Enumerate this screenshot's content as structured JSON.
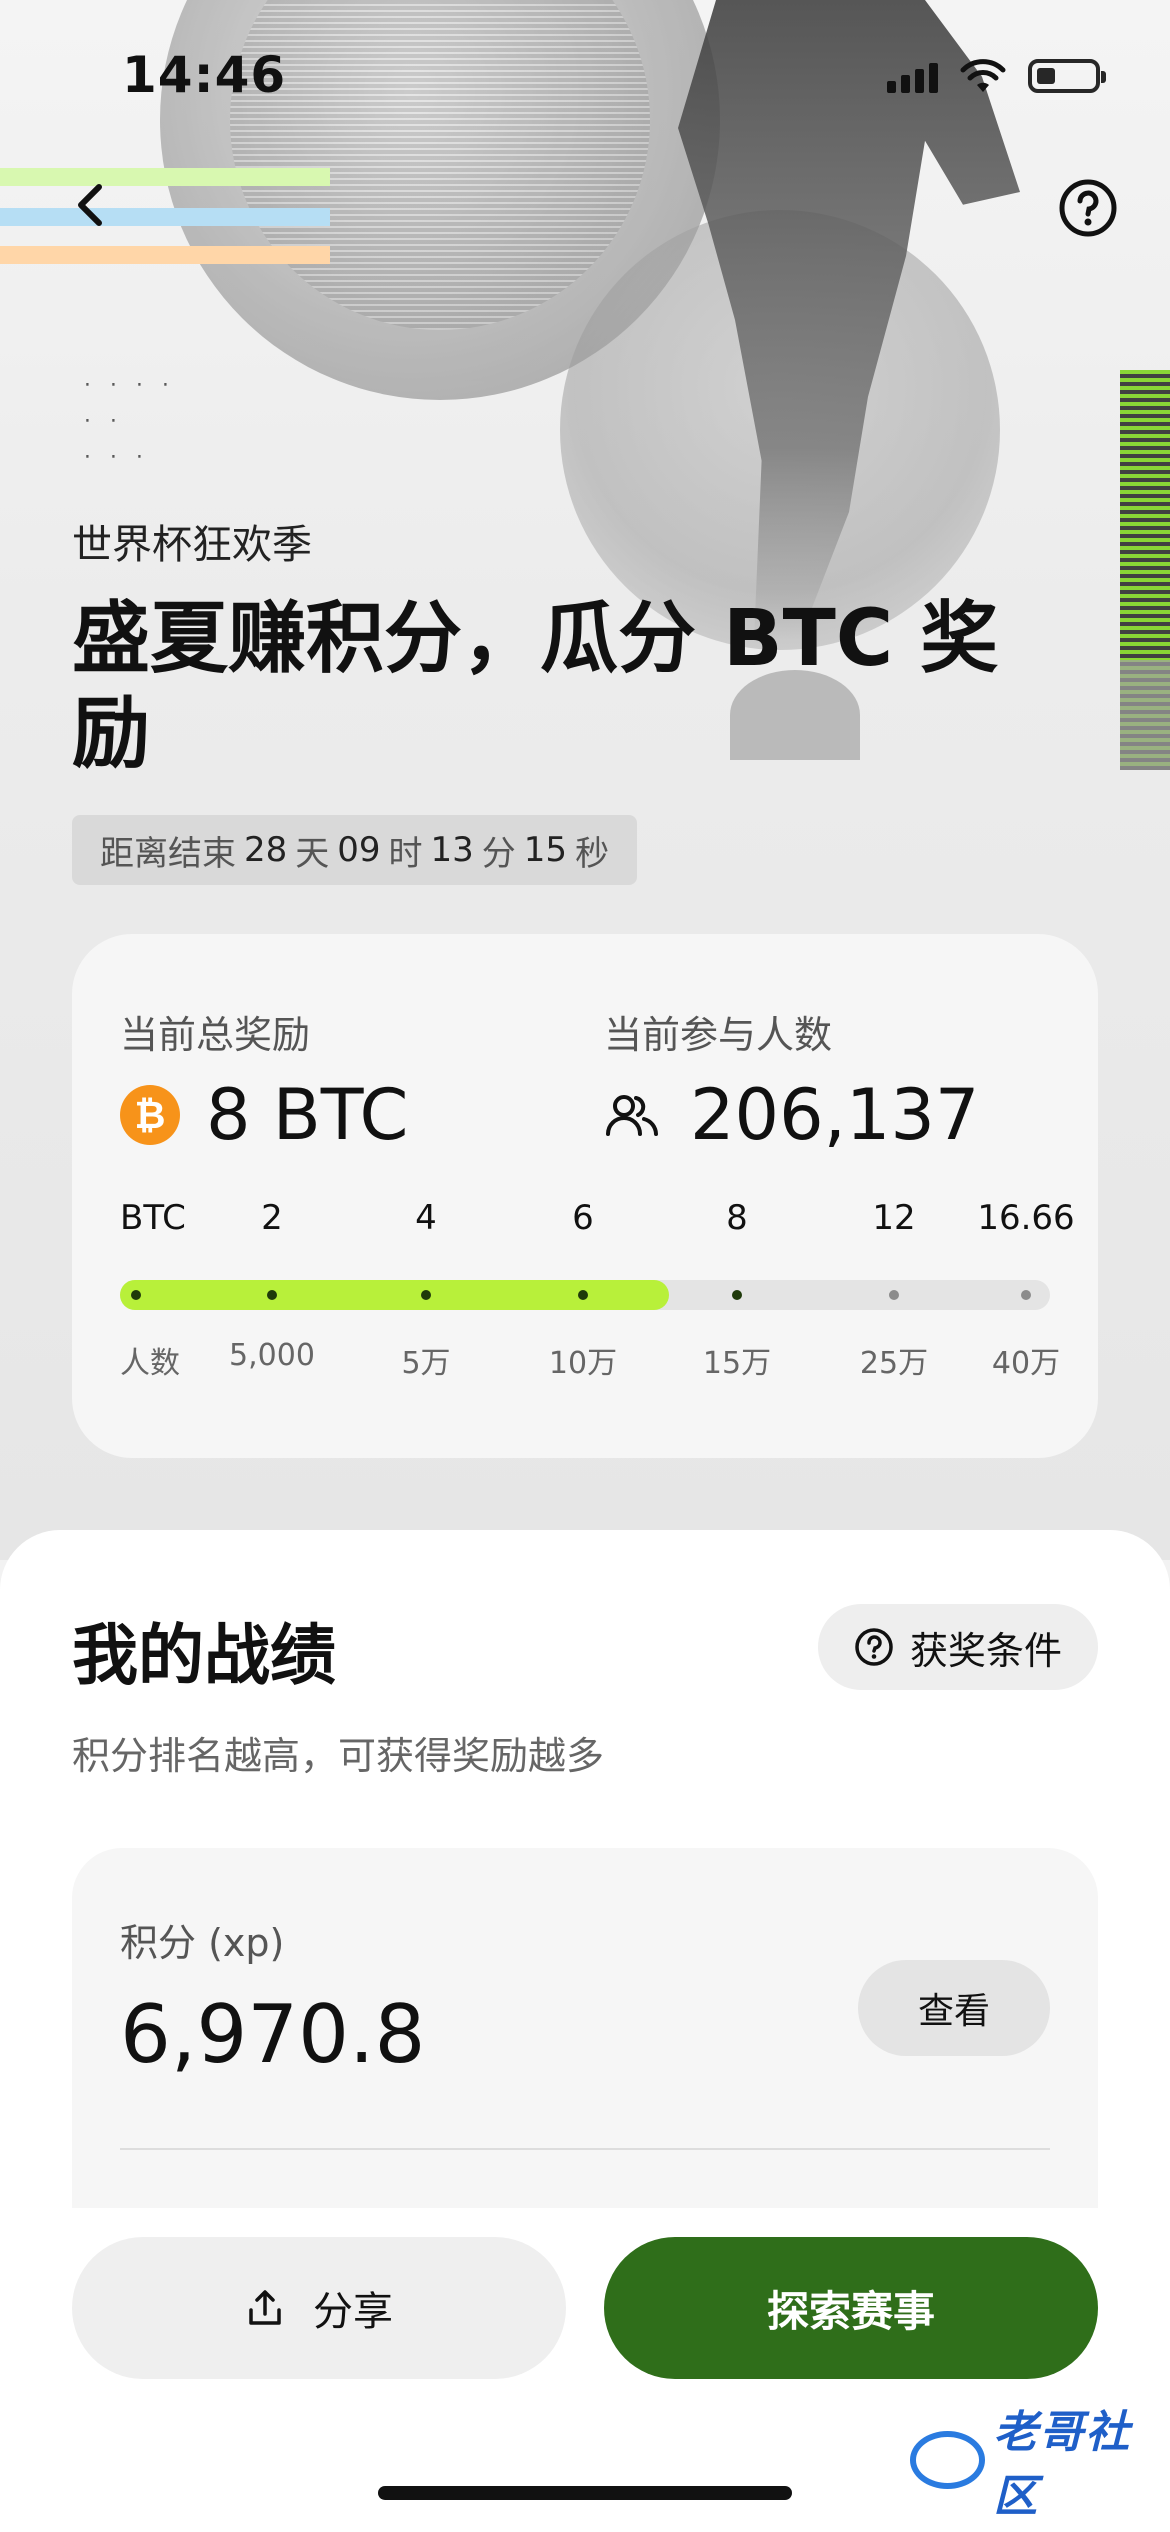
{
  "status_bar": {
    "time": "14:46"
  },
  "hero": {
    "eyebrow": "世界杯狂欢季",
    "headline": "盛夏赚积分，瓜分 BTC 奖励",
    "countdown": {
      "prefix": "距离结束",
      "days": "28",
      "days_unit": "天",
      "hours": "09",
      "hours_unit": "时",
      "minutes": "13",
      "minutes_unit": "分",
      "seconds": "15",
      "seconds_unit": "秒"
    }
  },
  "stats": {
    "reward_label": "当前总奖励",
    "reward_value": "8 BTC",
    "participants_label": "当前参与人数",
    "participants_value": "206,137",
    "scale_top_label": "BTC",
    "scale_bottom_label": "人数",
    "tiers": [
      {
        "btc": "2",
        "people": "5,000"
      },
      {
        "btc": "4",
        "people": "5万"
      },
      {
        "btc": "6",
        "people": "10万"
      },
      {
        "btc": "8",
        "people": "15万"
      },
      {
        "btc": "12",
        "people": "25万"
      },
      {
        "btc": "16.66",
        "people": "40万"
      }
    ],
    "progress_fraction": 0.59,
    "achieved_tiers": 4
  },
  "my_record": {
    "title": "我的战绩",
    "conditions_button": "获奖条件",
    "subtitle": "积分排名越高，可获得奖励越多",
    "xp_label": "积分 (xp)",
    "xp_value": "6,970.8",
    "view_button": "查看"
  },
  "actions": {
    "share": "分享",
    "explore": "探索赛事"
  },
  "watermark": {
    "text": "老哥社区"
  },
  "colors": {
    "accent_green": "#b8f03a",
    "primary_button": "#2f6e1a",
    "btc_orange": "#f7931a"
  }
}
